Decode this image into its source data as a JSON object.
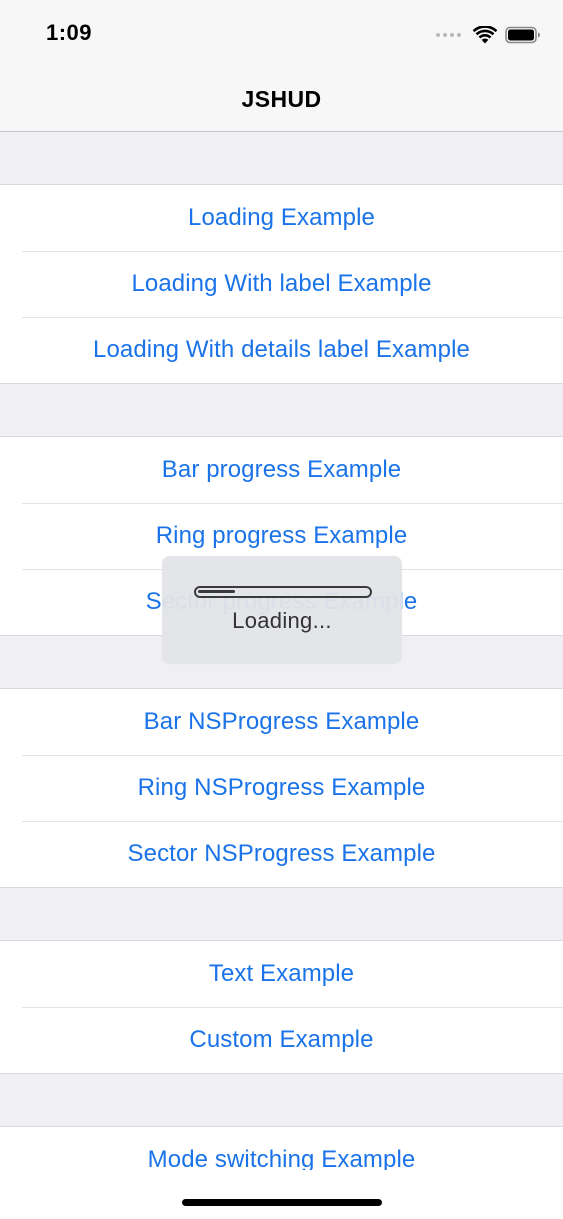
{
  "status_bar": {
    "time": "1:09",
    "icons": [
      "signal-dots-icon",
      "wifi-icon",
      "battery-icon"
    ]
  },
  "nav": {
    "title": "JSHUD"
  },
  "sections": [
    {
      "items": [
        "Loading Example",
        "Loading With label Example",
        "Loading With details label Example"
      ]
    },
    {
      "items": [
        "Bar progress Example",
        "Ring progress Example",
        "Sector progress Example"
      ]
    },
    {
      "items": [
        "Bar NSProgress Example",
        "Ring NSProgress Example",
        "Sector NSProgress Example"
      ]
    },
    {
      "items": [
        "Text Example",
        "Custom Example"
      ]
    },
    {
      "items": [
        "Mode switching Example"
      ]
    }
  ],
  "hud": {
    "label": "Loading...",
    "progress": 0.22
  },
  "colors": {
    "link": "#1a73e8",
    "background": "#efeff4",
    "nav_background": "#f7f7f7",
    "hud_background": "#e2e4e7"
  }
}
